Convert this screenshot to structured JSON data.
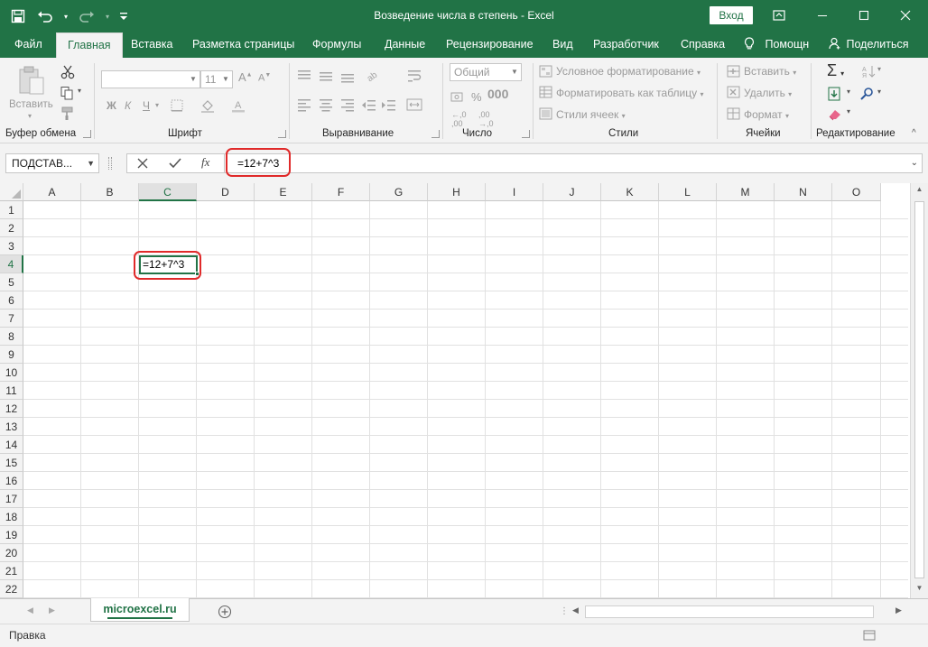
{
  "window": {
    "title": "Возведение числа в степень  -  Excel",
    "login_label": "Вход"
  },
  "tabs": [
    "Файл",
    "Главная",
    "Вставка",
    "Разметка страницы",
    "Формулы",
    "Данные",
    "Рецензирование",
    "Вид",
    "Разработчик",
    "Справка",
    "Помощн",
    "Поделиться"
  ],
  "active_tab": "Главная",
  "ribbon": {
    "clipboard": {
      "label": "Буфер обмена",
      "paste": "Вставить"
    },
    "font": {
      "label": "Шрифт",
      "size": "11",
      "bold": "Ж",
      "italic": "К",
      "underline": "Ч"
    },
    "alignment": {
      "label": "Выравнивание"
    },
    "number": {
      "label": "Число",
      "format": "Общий"
    },
    "styles": {
      "label": "Стили",
      "conditional": "Условное форматирование",
      "as_table": "Форматировать как таблицу",
      "cell_styles": "Стили ячеек"
    },
    "cells": {
      "label": "Ячейки",
      "insert": "Вставить",
      "delete": "Удалить",
      "format": "Формат"
    },
    "editing": {
      "label": "Редактирование"
    }
  },
  "formula_bar": {
    "name_box": "ПОДСТАВ...",
    "fx": "fx",
    "formula": "=12+7^3"
  },
  "grid": {
    "columns": [
      "A",
      "B",
      "C",
      "D",
      "E",
      "F",
      "G",
      "H",
      "I",
      "J",
      "K",
      "L",
      "M",
      "N",
      "O"
    ],
    "rows": [
      "1",
      "2",
      "3",
      "4",
      "5",
      "6",
      "7",
      "8",
      "9",
      "10",
      "11",
      "12",
      "13",
      "14",
      "15",
      "16",
      "17",
      "18",
      "19",
      "20",
      "21",
      "22"
    ],
    "active_column": "C",
    "active_row": "4",
    "active_cell_text": "=12+7^3"
  },
  "sheet_tabs": [
    "microexcel.ru"
  ],
  "status_bar": {
    "mode": "Правка"
  },
  "colors": {
    "brand": "#217346",
    "highlight": "#e02a2a"
  }
}
